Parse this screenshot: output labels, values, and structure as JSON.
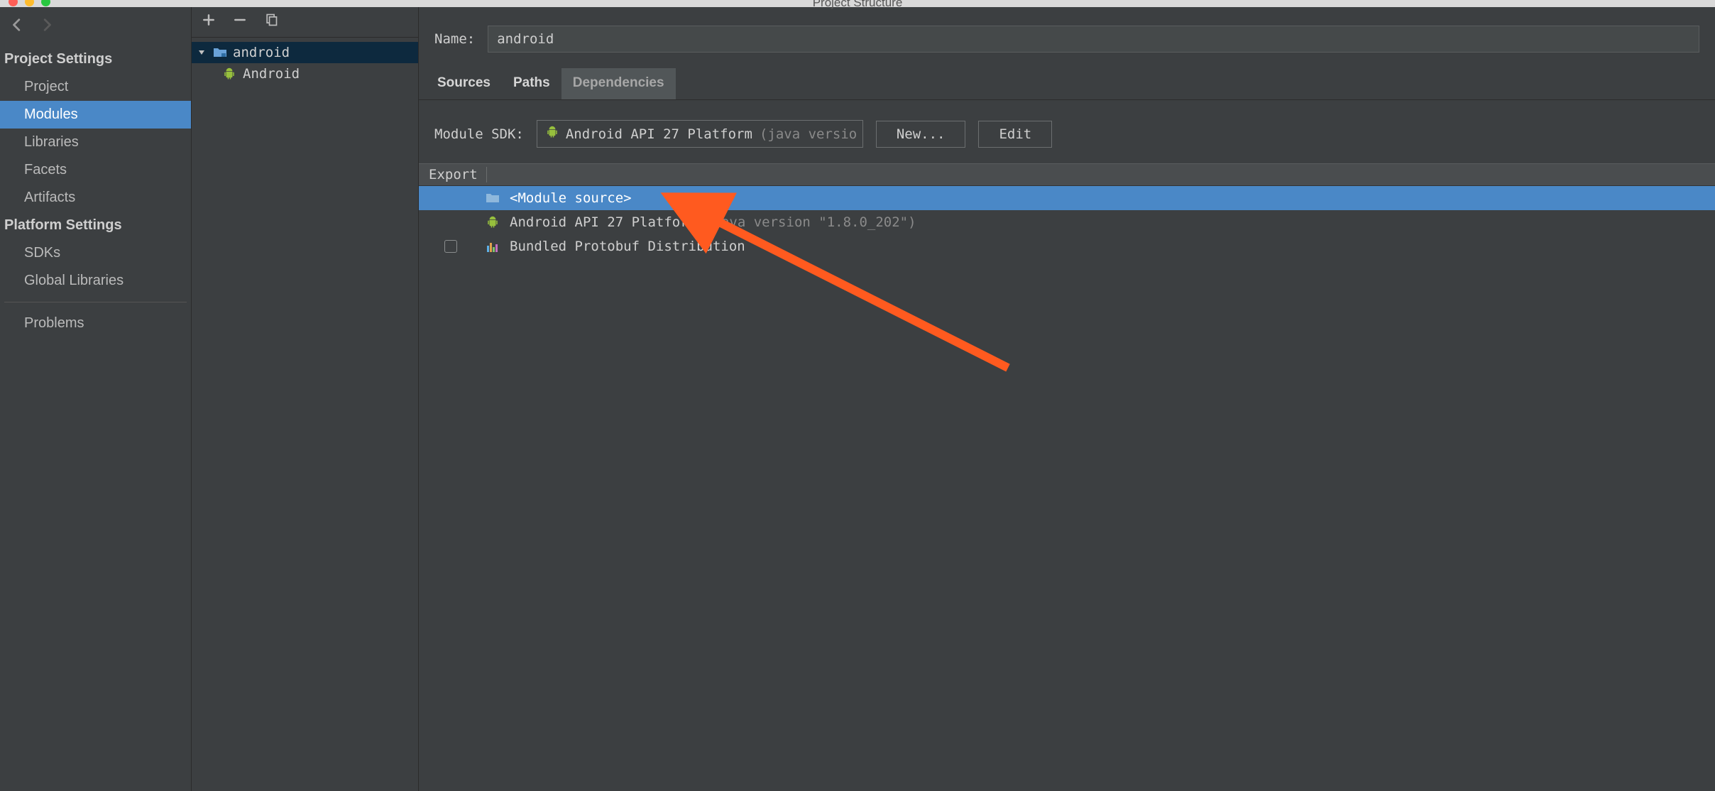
{
  "window": {
    "title": "Project Structure"
  },
  "sidebar": {
    "heading_project": "Project Settings",
    "heading_platform": "Platform Settings",
    "items": {
      "project": "Project",
      "modules": "Modules",
      "libraries": "Libraries",
      "facets": "Facets",
      "artifacts": "Artifacts",
      "sdks": "SDKs",
      "global_libs": "Global Libraries",
      "problems": "Problems"
    }
  },
  "modules_tree": {
    "root": "android",
    "child": "Android"
  },
  "detail": {
    "name_label": "Name:",
    "name_value": "android",
    "tabs": {
      "sources": "Sources",
      "paths": "Paths",
      "dependencies": "Dependencies"
    },
    "sdk_label": "Module SDK:",
    "sdk_value": "Android API 27 Platform",
    "sdk_hint": "(java versio",
    "btn_new": "New...",
    "btn_edit": "Edit",
    "export_header": "Export",
    "deps": [
      {
        "label": "<Module source>"
      },
      {
        "label": "Android API 27 Platform",
        "hint": "(java version \"1.8.0_202\")"
      },
      {
        "label": "Bundled Protobuf Distribution"
      }
    ]
  }
}
